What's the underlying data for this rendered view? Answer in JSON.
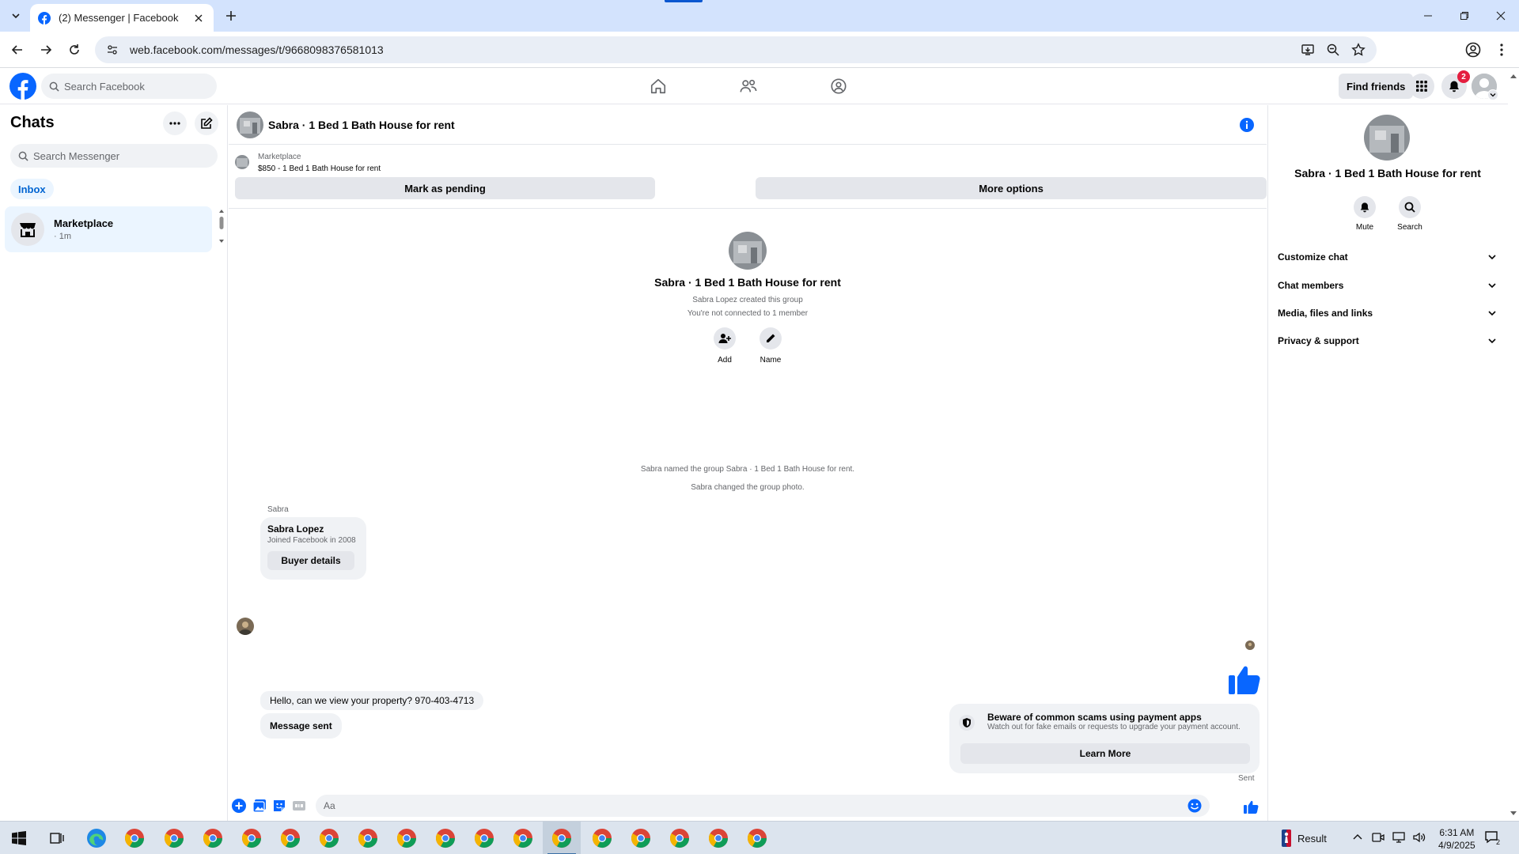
{
  "browser": {
    "tab_title": "(2) Messenger | Facebook",
    "url": "web.facebook.com/messages/t/9668098376581013"
  },
  "fb_nav": {
    "search_placeholder": "Search Facebook",
    "find_friends_label": "Find friends",
    "notification_count": "2"
  },
  "sidebar": {
    "title": "Chats",
    "search_placeholder": "Search Messenger",
    "filter_label": "Inbox",
    "chats": [
      {
        "name": "Marketplace",
        "time": "· 1m"
      }
    ]
  },
  "conversation": {
    "title": "Sabra · 1 Bed 1 Bath House for rent",
    "marketplace": {
      "label": "Marketplace",
      "listing": "$850 - 1 Bed 1 Bath House for rent",
      "pending_button": "Mark as pending",
      "options_button": "More options"
    },
    "intro": {
      "title": "Sabra · 1 Bed 1 Bath House for rent",
      "created": "Sabra Lopez created this group",
      "connected": "You're not connected to 1 member",
      "add_label": "Add",
      "name_label": "Name"
    },
    "system_messages": [
      "Sabra named the group Sabra · 1 Bed 1 Bath House for rent.",
      "Sabra changed the group photo."
    ],
    "sender_label": "Sabra",
    "buyer_card": {
      "name": "Sabra Lopez",
      "joined": "Joined Facebook in 2008",
      "button": "Buyer details"
    },
    "messages": [
      "Hello, can we view your property? 970-403-4713",
      "Message sent"
    ],
    "scam_warning": {
      "title": "Beware of common scams using payment apps",
      "subtitle": "Watch out for fake emails or requests to upgrade your payment account.",
      "button": "Learn More"
    },
    "sent_status": "Sent",
    "composer_placeholder": "Aa"
  },
  "right_panel": {
    "title": "Sabra · 1 Bed 1 Bath House for rent",
    "mute_label": "Mute",
    "search_label": "Search",
    "sections": [
      "Customize chat",
      "Chat members",
      "Media, files and links",
      "Privacy & support"
    ]
  },
  "taskbar": {
    "weather_label": "Result",
    "time": "6:31 AM",
    "date": "4/9/2025",
    "notification_count": "2"
  },
  "colors": {
    "fb_blue": "#0866ff",
    "tab_bar": "#d3e3fd",
    "selected_chat": "#ebf5ff",
    "bubble": "#f0f2f5"
  }
}
